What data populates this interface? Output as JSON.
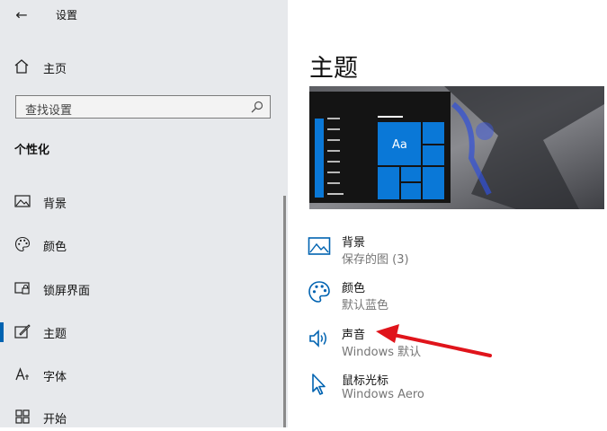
{
  "window": {
    "title": "设置"
  },
  "sidebar": {
    "home_label": "主页",
    "search_placeholder": "查找设置",
    "section_title": "个性化",
    "items": [
      {
        "label": "背景",
        "icon": "image-icon"
      },
      {
        "label": "颜色",
        "icon": "palette-icon"
      },
      {
        "label": "锁屏界面",
        "icon": "lock-screen-icon"
      },
      {
        "label": "主题",
        "icon": "brush-icon",
        "active": true
      },
      {
        "label": "字体",
        "icon": "font-icon"
      },
      {
        "label": "开始",
        "icon": "start-grid-icon"
      }
    ]
  },
  "main": {
    "title": "主题",
    "preview_tile_text": "Aa",
    "entries": [
      {
        "label": "背景",
        "value": "保存的图 (3)",
        "icon": "image-icon"
      },
      {
        "label": "颜色",
        "value": "默认蓝色",
        "icon": "palette-icon"
      },
      {
        "label": "声音",
        "value": "Windows 默认",
        "icon": "speaker-icon"
      },
      {
        "label": "鼠标光标",
        "value": "Windows Aero",
        "icon": "cursor-icon"
      }
    ]
  },
  "colors": {
    "accent": "#0063b1",
    "tile_blue": "#0a78d7",
    "annotation_arrow": "#e0141b"
  }
}
